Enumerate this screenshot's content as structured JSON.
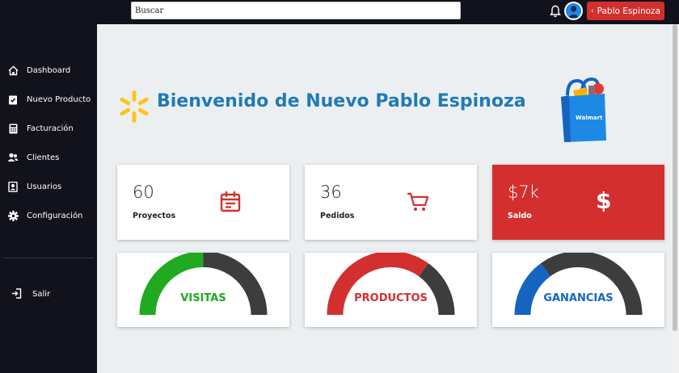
{
  "topbar": {
    "search_placeholder": "Buscar",
    "user_label": "Pablo Espinoza",
    "bell_icon": "bell-icon",
    "avatar_icon": "user-avatar-icon"
  },
  "sidebar": {
    "items": [
      {
        "label": "Dashboard",
        "icon": "home-icon"
      },
      {
        "label": "Nuevo Producto",
        "icon": "clipboard-check-icon"
      },
      {
        "label": "Facturación",
        "icon": "calculator-icon"
      },
      {
        "label": "Clientes",
        "icon": "users-icon"
      },
      {
        "label": "Usuarios",
        "icon": "id-card-icon"
      },
      {
        "label": "Configuración",
        "icon": "gear-icon"
      }
    ],
    "logout_label": "Salir"
  },
  "welcome": {
    "title": "Bienvenido de Nuevo Pablo Espinoza",
    "bag_label": "Walmart"
  },
  "stats": [
    {
      "value": "60",
      "label": "Proyectos",
      "icon": "calendar-icon"
    },
    {
      "value": "36",
      "label": "Pedidos",
      "icon": "cart-icon"
    },
    {
      "value": "$7k",
      "label": "Saldo",
      "icon": "dollar-icon",
      "symbol": "$"
    }
  ],
  "gauges": [
    {
      "label": "VISITAS",
      "value": 0.5,
      "color": "#1faa1f"
    },
    {
      "label": "PRODUCTOS",
      "value": 0.7,
      "color": "#d32f2f"
    },
    {
      "label": "GANANCIAS",
      "value": 0.3,
      "color": "#1565c0"
    }
  ],
  "colors": {
    "sidebar_bg": "#12121c",
    "title": "#1f7bb6",
    "accent_red": "#d32f2f",
    "walmart_yellow": "#ffc220",
    "gauge_track": "#3d3d3d"
  }
}
